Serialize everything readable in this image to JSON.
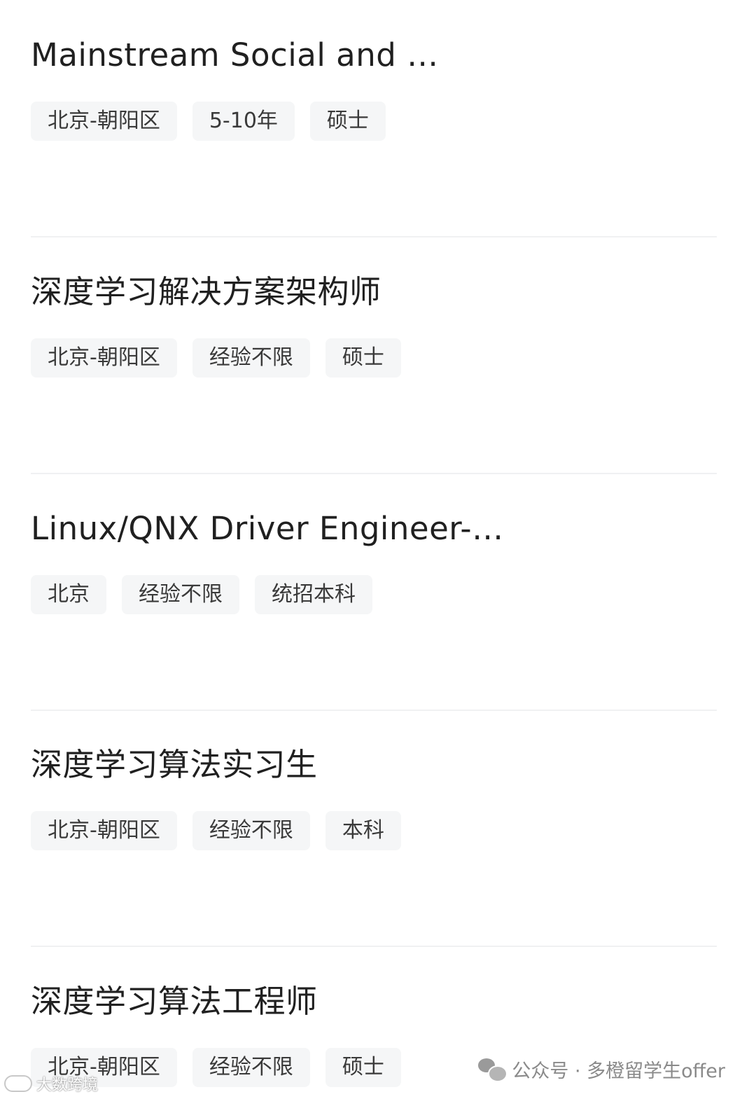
{
  "jobs": [
    {
      "title": "Mainstream Social and …",
      "tags": [
        "北京-朝阳区",
        "5-10年",
        "硕士"
      ]
    },
    {
      "title": "深度学习解决方案架构师",
      "tags": [
        "北京-朝阳区",
        "经验不限",
        "硕士"
      ]
    },
    {
      "title": "Linux/QNX Driver Engineer-…",
      "tags": [
        "北京",
        "经验不限",
        "统招本科"
      ]
    },
    {
      "title": "深度学习算法实习生",
      "tags": [
        "北京-朝阳区",
        "经验不限",
        "本科"
      ]
    },
    {
      "title": "深度学习算法工程师",
      "tags": [
        "北京-朝阳区",
        "经验不限",
        "硕士"
      ]
    }
  ],
  "watermark": {
    "icon": "wechat-icon",
    "text": "公众号 · 多橙留学生offer"
  },
  "corner_mark": {
    "icon": "logo-icon",
    "text": "大数跨境"
  },
  "colors": {
    "tag_background": "#f5f6f7",
    "title_text": "#202020",
    "tag_text": "#3a3a3a",
    "divider": "#f0f1f2"
  }
}
